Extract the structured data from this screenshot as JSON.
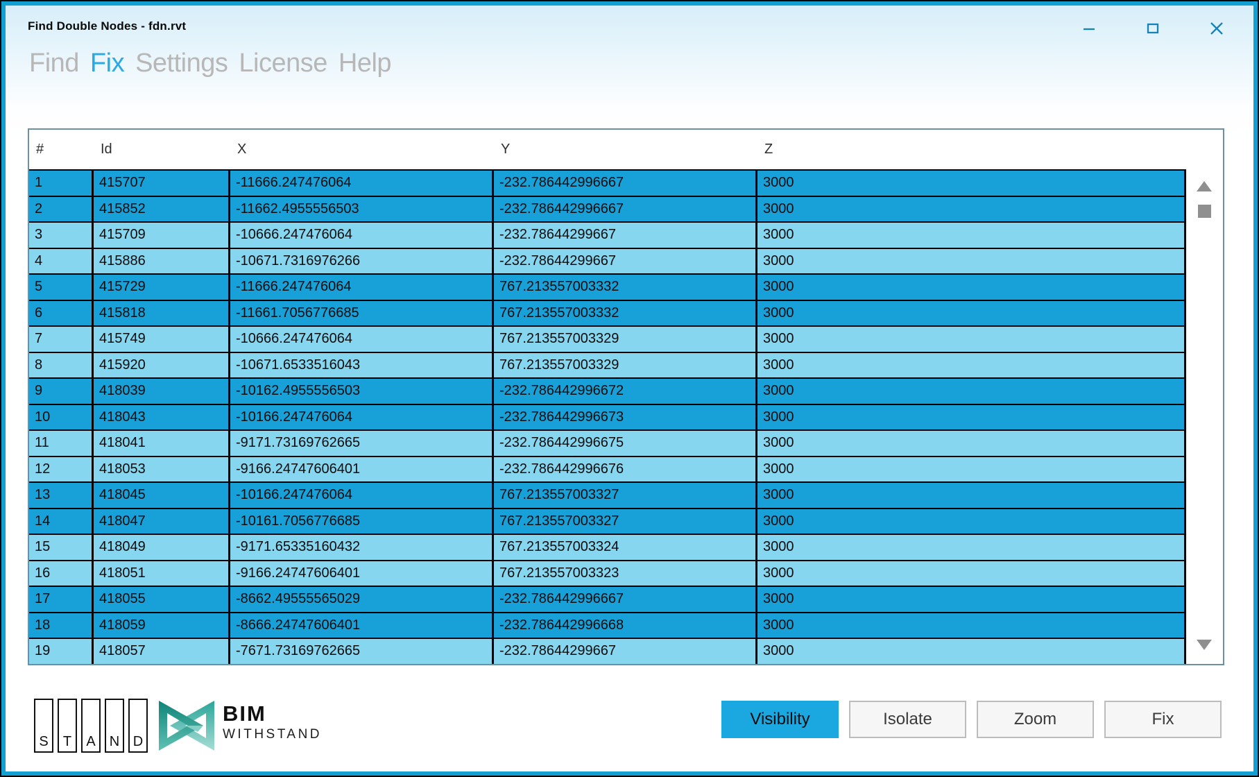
{
  "window": {
    "title": "Find Double Nodes - fdn.rvt",
    "controls": [
      {
        "name": "minimize",
        "icon": "minimize-icon"
      },
      {
        "name": "maximize",
        "icon": "maximize-icon"
      },
      {
        "name": "close",
        "icon": "close-icon"
      }
    ]
  },
  "menu": {
    "items": [
      {
        "label": "Find",
        "active": false
      },
      {
        "label": "Fix",
        "active": true
      },
      {
        "label": "Settings",
        "active": false
      },
      {
        "label": "License",
        "active": false
      },
      {
        "label": "Help",
        "active": false
      }
    ]
  },
  "table": {
    "columns": [
      "#",
      "Id",
      "X",
      "Y",
      "Z"
    ],
    "rows": [
      {
        "n": "1",
        "id": "415707",
        "x": "-11666.247476064",
        "y": "-232.786442996667",
        "z": "3000",
        "shade": "dark"
      },
      {
        "n": "2",
        "id": "415852",
        "x": "-11662.4955556503",
        "y": "-232.786442996667",
        "z": "3000",
        "shade": "dark"
      },
      {
        "n": "3",
        "id": "415709",
        "x": "-10666.247476064",
        "y": "-232.78644299667",
        "z": "3000",
        "shade": "light"
      },
      {
        "n": "4",
        "id": "415886",
        "x": "-10671.7316976266",
        "y": "-232.78644299667",
        "z": "3000",
        "shade": "light"
      },
      {
        "n": "5",
        "id": "415729",
        "x": "-11666.247476064",
        "y": "767.213557003332",
        "z": "3000",
        "shade": "dark"
      },
      {
        "n": "6",
        "id": "415818",
        "x": "-11661.7056776685",
        "y": "767.213557003332",
        "z": "3000",
        "shade": "dark"
      },
      {
        "n": "7",
        "id": "415749",
        "x": "-10666.247476064",
        "y": "767.213557003329",
        "z": "3000",
        "shade": "light"
      },
      {
        "n": "8",
        "id": "415920",
        "x": "-10671.6533516043",
        "y": "767.213557003329",
        "z": "3000",
        "shade": "light"
      },
      {
        "n": "9",
        "id": "418039",
        "x": "-10162.4955556503",
        "y": "-232.786442996672",
        "z": "3000",
        "shade": "dark"
      },
      {
        "n": "10",
        "id": "418043",
        "x": "-10166.247476064",
        "y": "-232.786442996673",
        "z": "3000",
        "shade": "dark"
      },
      {
        "n": "11",
        "id": "418041",
        "x": "-9171.73169762665",
        "y": "-232.786442996675",
        "z": "3000",
        "shade": "light"
      },
      {
        "n": "12",
        "id": "418053",
        "x": "-9166.24747606401",
        "y": "-232.786442996676",
        "z": "3000",
        "shade": "light"
      },
      {
        "n": "13",
        "id": "418045",
        "x": "-10166.247476064",
        "y": "767.213557003327",
        "z": "3000",
        "shade": "dark"
      },
      {
        "n": "14",
        "id": "418047",
        "x": "-10161.7056776685",
        "y": "767.213557003327",
        "z": "3000",
        "shade": "dark"
      },
      {
        "n": "15",
        "id": "418049",
        "x": "-9171.65335160432",
        "y": "767.213557003324",
        "z": "3000",
        "shade": "light"
      },
      {
        "n": "16",
        "id": "418051",
        "x": "-9166.24747606401",
        "y": "767.213557003323",
        "z": "3000",
        "shade": "light"
      },
      {
        "n": "17",
        "id": "418055",
        "x": "-8662.49555565029",
        "y": "-232.786442996667",
        "z": "3000",
        "shade": "dark"
      },
      {
        "n": "18",
        "id": "418059",
        "x": "-8666.24747606401",
        "y": "-232.786442996668",
        "z": "3000",
        "shade": "dark"
      },
      {
        "n": "19",
        "id": "418057",
        "x": "-7671.73169762665",
        "y": "-232.78644299667",
        "z": "3000",
        "shade": "light"
      }
    ],
    "scrollbar": {
      "up_icon": "scroll-up-icon",
      "down_icon": "scroll-down-icon",
      "thumb": "scroll-thumb"
    }
  },
  "footer": {
    "stand_letters": [
      "S",
      "T",
      "A",
      "N",
      "D"
    ],
    "brand": {
      "line1": "BIM",
      "line2": "WITHSTAND",
      "icon": "bim-withstand-logo-icon"
    },
    "buttons": [
      {
        "label": "Visibility",
        "active": true
      },
      {
        "label": "Isolate",
        "active": false
      },
      {
        "label": "Zoom",
        "active": false
      },
      {
        "label": "Fix",
        "active": false
      }
    ]
  },
  "colors": {
    "accent": "#29ABE2",
    "row-dark": "#18A0D8",
    "row-light": "#86D6EF",
    "btn-active": "#1BA7DF",
    "border-accent": "#12A0D2",
    "titlebar-top": "#D7EEF9",
    "menu-gray": "#B7B7B7",
    "table-border": "#6B8FA5",
    "scroll-gray": "#8F8F8F",
    "control-blue": "#1583B5",
    "logo-teal-dark": "#0F8478",
    "logo-teal-light": "#86CFC5"
  }
}
